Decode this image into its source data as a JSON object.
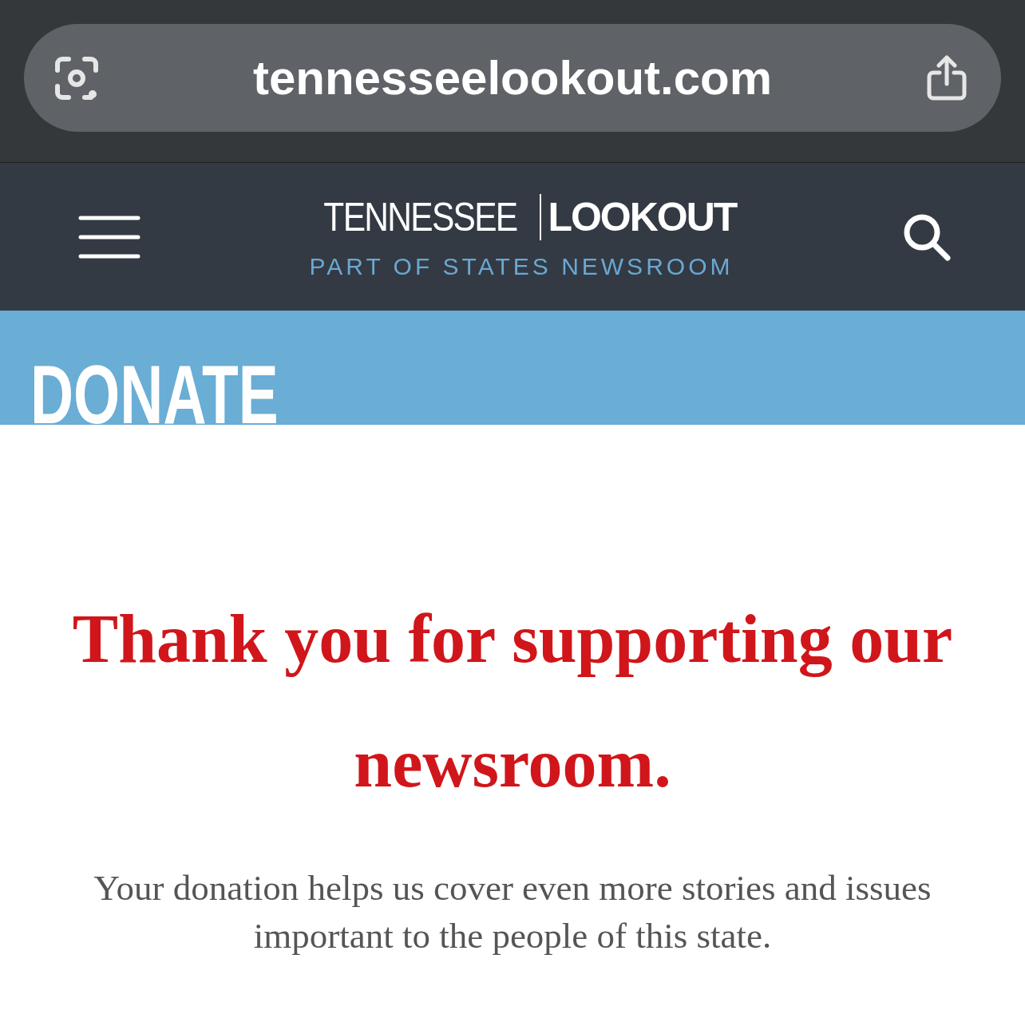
{
  "browser": {
    "url": "tennesseelookout.com"
  },
  "header": {
    "logo_light": "TENNESSEE",
    "logo_bold": "LOOKOUT",
    "tagline": "PART OF STATES NEWSROOM"
  },
  "banner": {
    "title": "DONATE"
  },
  "heading": "Thank you for supporting our newsroom.",
  "body": "Your donation helps us cover even more stories and issues important to the people of this state."
}
